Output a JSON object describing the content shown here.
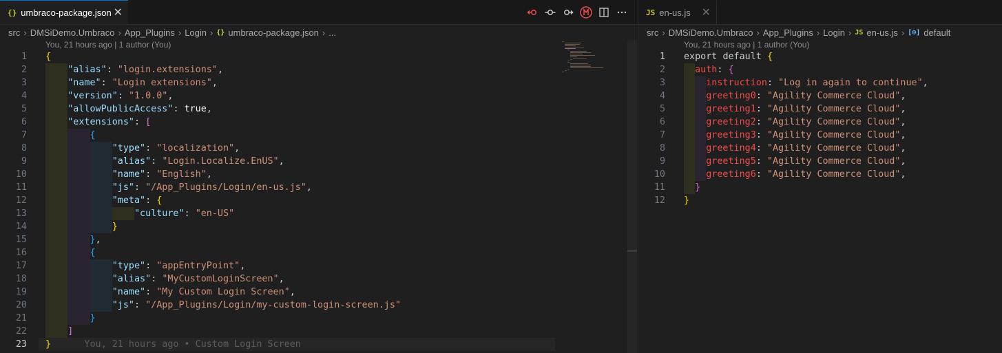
{
  "left": {
    "tab": {
      "icon": "{}",
      "label": "umbraco-package.json",
      "close": "✕"
    },
    "actions": [
      "git-compare-icon",
      "git-commit-icon",
      "git-next-icon",
      "source-control-icon",
      "split-editor-icon",
      "more-icon"
    ],
    "breadcrumb": [
      "src",
      "DMSiDemo.Umbraco",
      "App_Plugins",
      "Login",
      "umbraco-package.json",
      "..."
    ],
    "blame_header": "You, 21 hours ago | 1 author (You)",
    "inline_blame": "You, 21 hours ago • Custom Login Screen",
    "lines": [
      {
        "n": "1",
        "t": "{"
      },
      {
        "n": "2",
        "t": "    \"alias\": \"login.extensions\","
      },
      {
        "n": "3",
        "t": "    \"name\": \"Login extensions\","
      },
      {
        "n": "4",
        "t": "    \"version\": \"1.0.0\","
      },
      {
        "n": "5",
        "t": "    \"allowPublicAccess\": true,"
      },
      {
        "n": "6",
        "t": "    \"extensions\": ["
      },
      {
        "n": "7",
        "t": "        {"
      },
      {
        "n": "8",
        "t": "            \"type\": \"localization\","
      },
      {
        "n": "9",
        "t": "            \"alias\": \"Login.Localize.EnUS\","
      },
      {
        "n": "10",
        "t": "            \"name\": \"English\","
      },
      {
        "n": "11",
        "t": "            \"js\": \"/App_Plugins/Login/en-us.js\","
      },
      {
        "n": "12",
        "t": "            \"meta\": {"
      },
      {
        "n": "13",
        "t": "                \"culture\": \"en-US\""
      },
      {
        "n": "14",
        "t": "            }"
      },
      {
        "n": "15",
        "t": "        },"
      },
      {
        "n": "16",
        "t": "        {"
      },
      {
        "n": "17",
        "t": "            \"type\": \"appEntryPoint\","
      },
      {
        "n": "18",
        "t": "            \"alias\": \"MyCustomLoginScreen\","
      },
      {
        "n": "19",
        "t": "            \"name\": \"My Custom Login Screen\","
      },
      {
        "n": "20",
        "t": "            \"js\": \"/App_Plugins/Login/my-custom-login-screen.js\""
      },
      {
        "n": "21",
        "t": "        }"
      },
      {
        "n": "22",
        "t": "    ]"
      },
      {
        "n": "23",
        "t": "}"
      }
    ]
  },
  "right": {
    "tab": {
      "icon": "JS",
      "label": "en-us.js",
      "close": "✕"
    },
    "breadcrumb": [
      "src",
      "DMSiDemo.Umbraco",
      "App_Plugins",
      "Login",
      "en-us.js",
      "default"
    ],
    "blame_header": "You, 21 hours ago | 1 author (You)",
    "lines": [
      {
        "n": "1",
        "t": "export default {"
      },
      {
        "n": "2",
        "t": "  auth: {"
      },
      {
        "n": "3",
        "t": "    instruction: \"Log in again to continue\","
      },
      {
        "n": "4",
        "t": "    greeting0: \"Agility Commerce Cloud\","
      },
      {
        "n": "5",
        "t": "    greeting1: \"Agility Commerce Cloud\","
      },
      {
        "n": "6",
        "t": "    greeting2: \"Agility Commerce Cloud\","
      },
      {
        "n": "7",
        "t": "    greeting3: \"Agility Commerce Cloud\","
      },
      {
        "n": "8",
        "t": "    greeting4: \"Agility Commerce Cloud\","
      },
      {
        "n": "9",
        "t": "    greeting5: \"Agility Commerce Cloud\","
      },
      {
        "n": "10",
        "t": "    greeting6: \"Agility Commerce Cloud\","
      },
      {
        "n": "11",
        "t": "  }"
      },
      {
        "n": "12",
        "t": "}"
      }
    ]
  },
  "colors": {
    "json_key": "#9cdcfe",
    "string": "#ce9178",
    "keyword": "#569cd6",
    "bracket_gold": "#ffd700",
    "bracket_pink": "#da70d6",
    "bracket_blue": "#179fff",
    "accent": "#0078d4"
  }
}
